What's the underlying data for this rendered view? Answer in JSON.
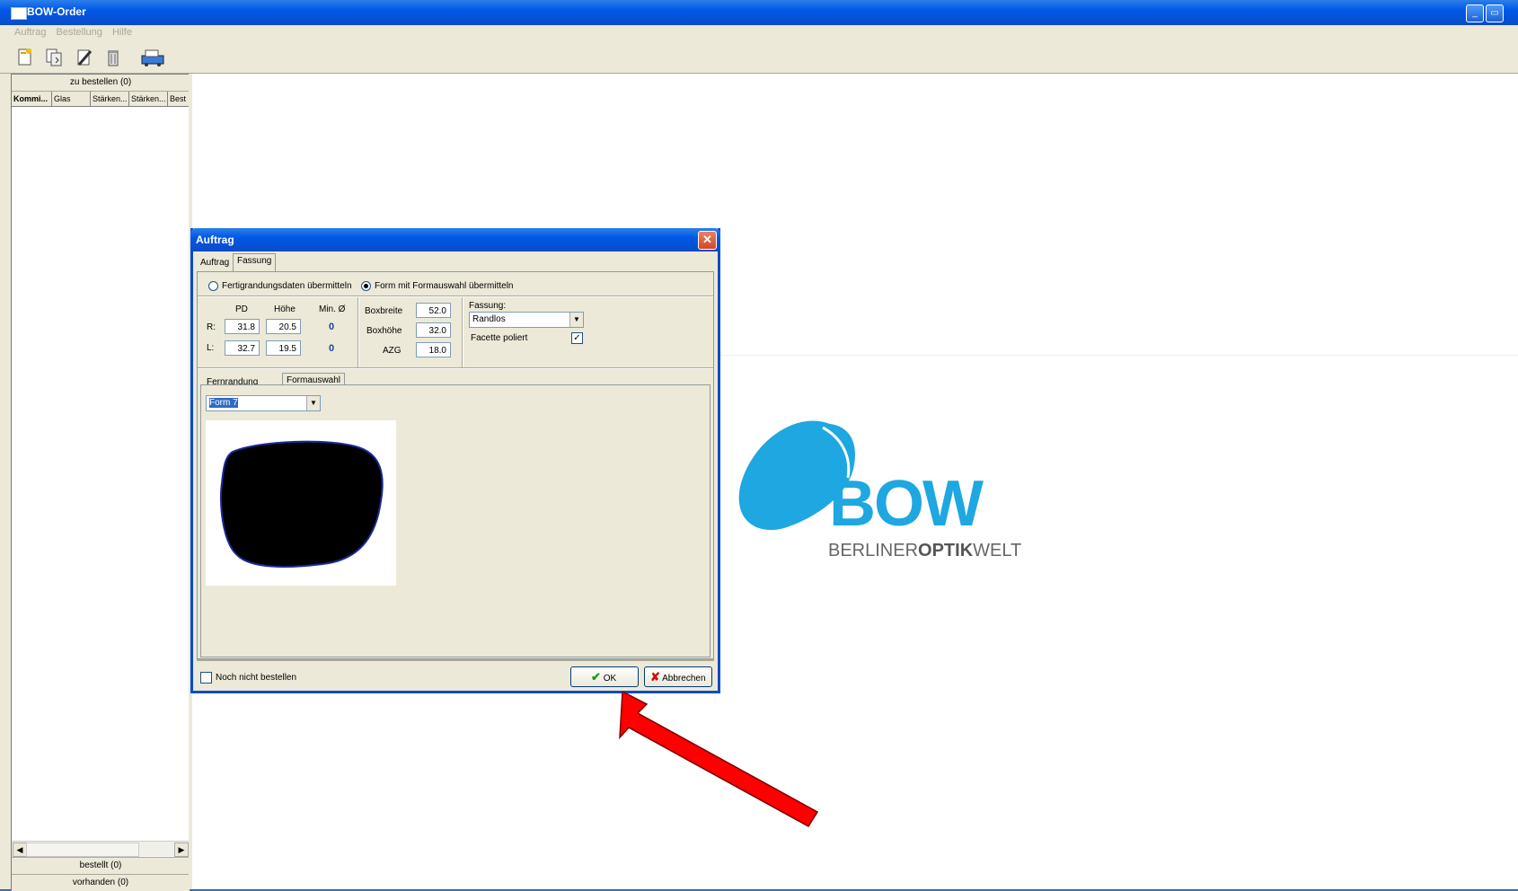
{
  "window": {
    "title": "BOW-Order"
  },
  "menu": [
    "Auftrag",
    "Bestellung",
    "Hilfe"
  ],
  "toolbar": {
    "icons": [
      "new-order-icon",
      "copy-order-icon",
      "edit-icon",
      "delete-icon",
      "send-order-icon"
    ]
  },
  "left_panel": {
    "header": "zu bestellen (0)",
    "columns": [
      "Kommi...",
      "Glas",
      "Stärken...",
      "Stärken...",
      "Best"
    ],
    "footer_bestellt": "bestellt (0)",
    "footer_vorhanden": "vorhanden (0)"
  },
  "logo": {
    "text_main": "BOW",
    "text_sub_1": "BERLINER",
    "text_sub_2": "OPTIK",
    "text_sub_3": "WELT",
    "color": "#1ea7e0"
  },
  "dialog": {
    "title": "Auftrag",
    "tabs": [
      "Auftrag",
      "Fassung"
    ],
    "radio_1": "Fertigrandungsdaten übermitteln",
    "radio_2": "Form mit Formauswahl übermitteln",
    "col_pd": "PD",
    "col_hoehe": "Höhe",
    "col_min": "Min. Ø",
    "row_r": "R:",
    "row_l": "L:",
    "r_pd": "31.8",
    "r_hoehe": "20.5",
    "r_min": "0",
    "l_pd": "32.7",
    "l_hoehe": "19.5",
    "l_min": "0",
    "boxbreite_label": "Boxbreite",
    "boxbreite": "52.0",
    "boxhoehe_label": "Boxhöhe",
    "boxhoehe": "32.0",
    "azg_label": "AZG",
    "azg": "18.0",
    "fassung_label": "Fassung:",
    "fassung_value": "Randlos",
    "facette_label": "Facette poliert",
    "inner_tabs": [
      "Fernrandung Tracer",
      "Formauswahl"
    ],
    "form_select": "Form 7",
    "noch_nicht_label": "Noch nicht bestellen",
    "ok_label": "OK",
    "cancel_label": "Abbrechen"
  }
}
